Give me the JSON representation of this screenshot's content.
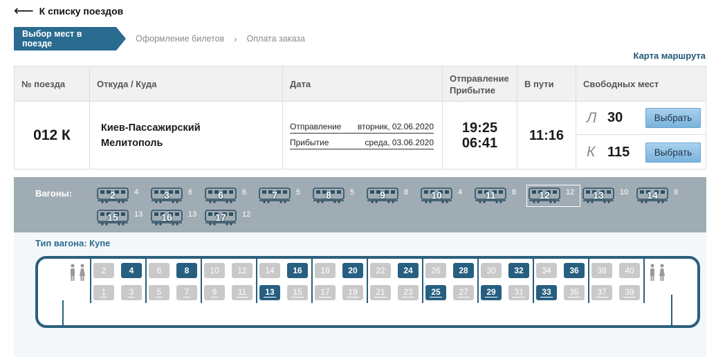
{
  "nav": {
    "back_label": "К списку поездов"
  },
  "steps": [
    "Выбор мест в поезде",
    "Оформление билетов",
    "Оплата заказа"
  ],
  "route_map_label": "Карта маршрута",
  "table": {
    "headers": {
      "train_no": "№ поезда",
      "from_to": "Откуда / Куда",
      "date": "Дата",
      "dep_arr_1": "Отправление",
      "dep_arr_2": "Прибытие",
      "travel": "В пути",
      "free": "Свободных мест"
    },
    "row": {
      "train_no": "012 К",
      "from": "Киев-Пассажирский",
      "to": "Мелитополь",
      "departure_label": "Отправление",
      "departure_date": "вторник, 02.06.2020",
      "arrival_label": "Прибытие",
      "arrival_date": "среда, 03.06.2020",
      "dep_time": "19:25",
      "arr_time": "06:41",
      "travel_time": "11:16",
      "classes": [
        {
          "type": "Л",
          "count": "30",
          "button": "Выбрать"
        },
        {
          "type": "К",
          "count": "115",
          "button": "Выбрать"
        }
      ]
    }
  },
  "wagons": {
    "label": "Вагоны:",
    "selected": "12",
    "items": [
      {
        "num": "2",
        "free": "4"
      },
      {
        "num": "3",
        "free": "6"
      },
      {
        "num": "6",
        "free": "6"
      },
      {
        "num": "7",
        "free": "5"
      },
      {
        "num": "8",
        "free": "5"
      },
      {
        "num": "9",
        "free": "8"
      },
      {
        "num": "10",
        "free": "4"
      },
      {
        "num": "11",
        "free": "8"
      },
      {
        "num": "12",
        "free": "12"
      },
      {
        "num": "13",
        "free": "10"
      },
      {
        "num": "14",
        "free": "9"
      },
      {
        "num": "15",
        "free": "13"
      },
      {
        "num": "16",
        "free": "13"
      },
      {
        "num": "17",
        "free": "12"
      }
    ]
  },
  "coach": {
    "type_label": "Тип вагона: Купе",
    "upper": [
      {
        "n": "2",
        "free": false
      },
      {
        "n": "4",
        "free": true
      },
      {
        "n": "6",
        "free": false
      },
      {
        "n": "8",
        "free": true
      },
      {
        "n": "10",
        "free": false
      },
      {
        "n": "12",
        "free": false
      },
      {
        "n": "14",
        "free": false
      },
      {
        "n": "16",
        "free": true
      },
      {
        "n": "18",
        "free": false
      },
      {
        "n": "20",
        "free": true
      },
      {
        "n": "22",
        "free": false
      },
      {
        "n": "24",
        "free": true
      },
      {
        "n": "26",
        "free": false
      },
      {
        "n": "28",
        "free": true
      },
      {
        "n": "30",
        "free": false
      },
      {
        "n": "32",
        "free": true
      },
      {
        "n": "34",
        "free": false
      },
      {
        "n": "36",
        "free": true
      },
      {
        "n": "38",
        "free": false
      },
      {
        "n": "40",
        "free": false
      }
    ],
    "lower": [
      {
        "n": "1",
        "free": false
      },
      {
        "n": "3",
        "free": false
      },
      {
        "n": "5",
        "free": false
      },
      {
        "n": "7",
        "free": false
      },
      {
        "n": "9",
        "free": false
      },
      {
        "n": "11",
        "free": false
      },
      {
        "n": "13",
        "free": true
      },
      {
        "n": "15",
        "free": false
      },
      {
        "n": "17",
        "free": false
      },
      {
        "n": "19",
        "free": false
      },
      {
        "n": "21",
        "free": false
      },
      {
        "n": "23",
        "free": false
      },
      {
        "n": "25",
        "free": true
      },
      {
        "n": "27",
        "free": false
      },
      {
        "n": "29",
        "free": true
      },
      {
        "n": "31",
        "free": false
      },
      {
        "n": "33",
        "free": true
      },
      {
        "n": "35",
        "free": false
      },
      {
        "n": "37",
        "free": false
      },
      {
        "n": "39",
        "free": false
      }
    ]
  },
  "colors": {
    "accent": "#2a6c90",
    "free_seat": "#275f80",
    "taken_seat": "#c9c9c9",
    "wagon_bar": "#a0acb4"
  },
  "icons": {
    "back": "arrow-left-icon",
    "wagon": "wagon-icon",
    "wc": "toilet-icon"
  }
}
